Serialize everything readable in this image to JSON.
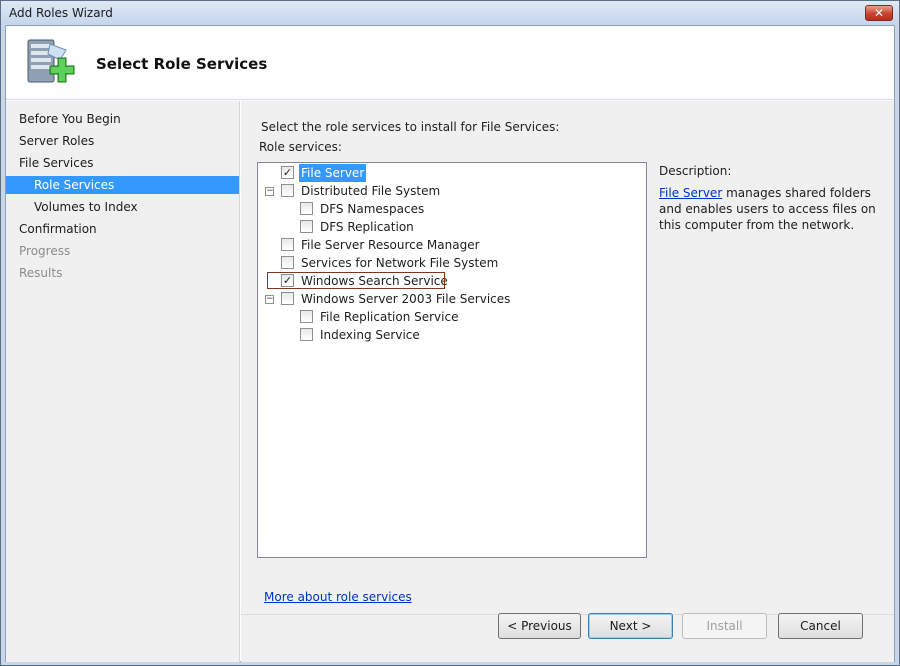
{
  "window": {
    "title": "Add Roles Wizard",
    "close_glyph": "✕"
  },
  "header": {
    "title": "Select Role Services",
    "icon": "server-add-icon"
  },
  "nav": {
    "items": [
      {
        "label": "Before You Begin",
        "state": "normal",
        "level": 0
      },
      {
        "label": "Server Roles",
        "state": "normal",
        "level": 0
      },
      {
        "label": "File Services",
        "state": "normal",
        "level": 0
      },
      {
        "label": "Role Services",
        "state": "selected",
        "level": 1
      },
      {
        "label": "Volumes to Index",
        "state": "normal",
        "level": 1
      },
      {
        "label": "Confirmation",
        "state": "normal",
        "level": 0
      },
      {
        "label": "Progress",
        "state": "disabled",
        "level": 0
      },
      {
        "label": "Results",
        "state": "disabled",
        "level": 0
      }
    ]
  },
  "main": {
    "instruction": "Select the role services to install for File Services:",
    "role_services_label": "Role services:",
    "tree": [
      {
        "label": "File Server",
        "checked": true,
        "expander": "",
        "selected": true
      },
      {
        "label": "Distributed File System",
        "checked": false,
        "expander": "−",
        "selected": false
      },
      {
        "label": "DFS Namespaces",
        "checked": false,
        "expander": "",
        "selected": false
      },
      {
        "label": "DFS Replication",
        "checked": false,
        "expander": "",
        "selected": false
      },
      {
        "label": "File Server Resource Manager",
        "checked": false,
        "expander": "",
        "selected": false
      },
      {
        "label": "Services for Network File System",
        "checked": false,
        "expander": "",
        "selected": false
      },
      {
        "label": "Windows Search Service",
        "checked": true,
        "expander": "",
        "selected": false
      },
      {
        "label": "Windows Server 2003 File Services",
        "checked": false,
        "expander": "−",
        "selected": false
      },
      {
        "label": "File Replication Service",
        "checked": false,
        "expander": "",
        "selected": false
      },
      {
        "label": "Indexing Service",
        "checked": false,
        "expander": "",
        "selected": false
      }
    ],
    "check_glyph": "✓",
    "description_label": "Description:",
    "description_link": "File Server",
    "description_text": " manages shared folders and enables users to access files on this computer from the network.",
    "more_link": "More about role services"
  },
  "footer": {
    "previous": "< Previous",
    "next": "Next >",
    "install": "Install",
    "cancel": "Cancel"
  },
  "colors": {
    "selection": "#3399ff",
    "link": "#0033cc",
    "focus_outline": "#7b3a1a"
  }
}
